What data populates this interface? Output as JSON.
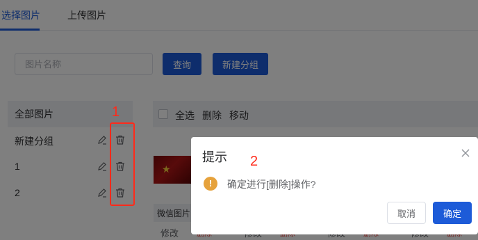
{
  "tabs": [
    {
      "label": "选择图片",
      "active": true
    },
    {
      "label": "上传图片",
      "active": false
    }
  ],
  "search": {
    "placeholder": "图片名称",
    "value": ""
  },
  "buttons": {
    "query": "查询",
    "new_group": "新建分组"
  },
  "groups": {
    "all_label": "全部图片",
    "items": [
      {
        "label": "新建分组"
      },
      {
        "label": "1"
      },
      {
        "label": "2"
      }
    ]
  },
  "toolbar": {
    "select_all": "全选",
    "delete": "删除",
    "move": "移动"
  },
  "image_list": {
    "caption": "微信图片",
    "actions": [
      {
        "modify": "修改",
        "delete": "删除"
      },
      {
        "modify": "修改",
        "delete": "删除"
      },
      {
        "modify": "修改",
        "delete": "删除"
      },
      {
        "modify": "修改",
        "delete": "删除"
      }
    ]
  },
  "annotations": {
    "label_1": "1",
    "label_2": "2"
  },
  "dialog": {
    "title": "提示",
    "message": "确定进行[删除]操作?",
    "cancel": "取消",
    "confirm": "确定",
    "warning_icon": "exclamation-icon"
  },
  "colors": {
    "primary": "#1d5bd8",
    "warning": "#e6a23c",
    "annotation": "#ff2a1a",
    "danger": "#e53935"
  }
}
